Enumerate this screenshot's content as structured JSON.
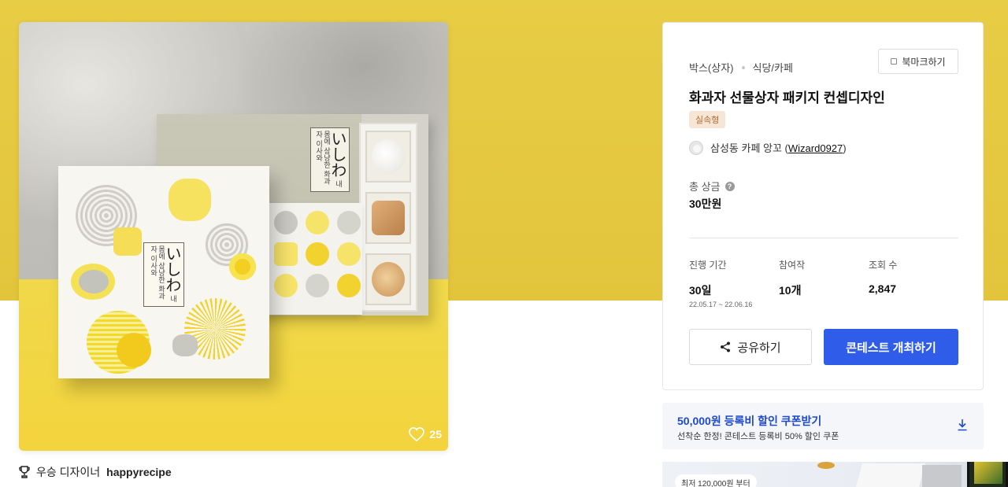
{
  "product": {
    "likes": "25",
    "box_label_small": "내 몸에 상냥한 화과자",
    "box_label_sub": "이사와",
    "box_label_big": "いしわ"
  },
  "award": {
    "label": "우승 디자이너",
    "designer": "happyrecipe"
  },
  "info": {
    "categories": [
      "박스(상자)",
      "식당/카페"
    ],
    "bookmark_label": "북마크하기",
    "title": "화과자 선물상자 패키지 컨셉디자인",
    "badge": "실속형",
    "host_name": "삼성동 카페 앙꼬 (",
    "host_id": "Wizard0927",
    "host_close": ")",
    "prize_label": "총 상금",
    "prize_help": "?",
    "prize_value": "30만원",
    "stats": {
      "period_label": "진행 기간",
      "period_value": "30일",
      "period_range": "22.05.17 ~ 22.06.16",
      "entries_label": "참여작",
      "entries_value": "10개",
      "views_label": "조회 수",
      "views_value": "2,847"
    },
    "share_label": "공유하기",
    "host_button_label": "콘테스트 개최하기"
  },
  "coupon": {
    "title": "50,000원 등록비 할인 쿠폰받기",
    "subtitle": "선착순 한정! 콘테스트 등록비 50% 할인 쿠폰"
  },
  "promo": {
    "tag": "최저 120,000원 부터"
  },
  "colors": {
    "hero_yellow": "#e5c840",
    "primary_blue": "#2f5ce8",
    "coupon_blue": "#1e4ac9",
    "badge_bg": "#f7e6d6",
    "badge_text": "#b26a2e"
  },
  "icons": {
    "like": "heart-icon",
    "award": "trophy-icon",
    "bookmark": "bookmark-icon",
    "share": "share-icon",
    "download": "download-icon",
    "help": "question-icon"
  }
}
